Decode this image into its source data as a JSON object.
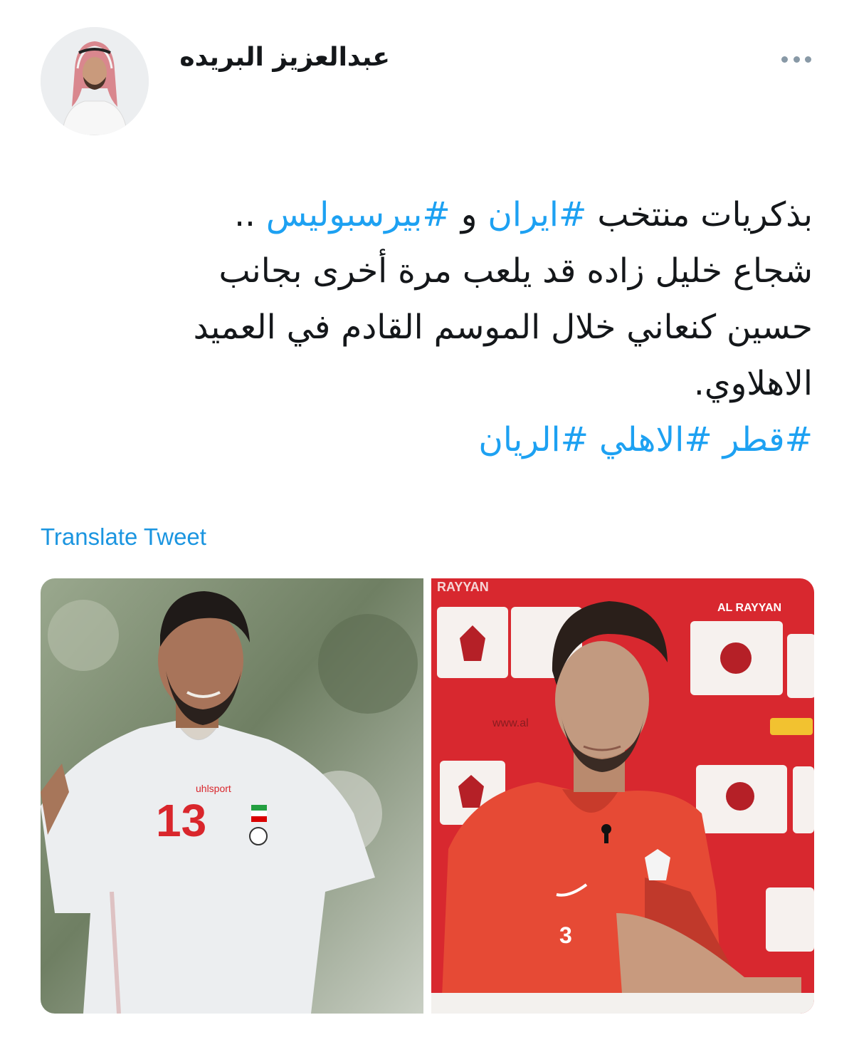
{
  "author": {
    "display_name": "عبدالعزيز البريده"
  },
  "tweet": {
    "line1_text": "بذكريات منتخب ",
    "line1_tag1": "#ايران",
    "line1_join": " و ",
    "line1_tag2": "#بيرسبوليس",
    "line1_end": " ..",
    "line2": "شجاع خليل زاده قد يلعب مرة أخرى بجانب",
    "line3": "حسين كنعاني خلال الموسم القادم في العميد",
    "line4": "الاهلاوي.",
    "tags": [
      "#قطر",
      "#الاهلي",
      "#الريان"
    ]
  },
  "translate_label": "Translate Tweet",
  "media": {
    "left_photo": {
      "jersey_number": "13",
      "brand_text": "uhlsport"
    },
    "right_photo": {
      "banner_text": "AL RAYYAN",
      "top_text": "RAYYAN",
      "web_text": "www.al",
      "jersey_number": "3"
    }
  },
  "colors": {
    "hashtag": "#1da1f2",
    "translate": "#1b95e0",
    "text": "#14171a",
    "more_icon": "#8899a6"
  },
  "icons": {
    "more": "more-horizontal-icon"
  }
}
